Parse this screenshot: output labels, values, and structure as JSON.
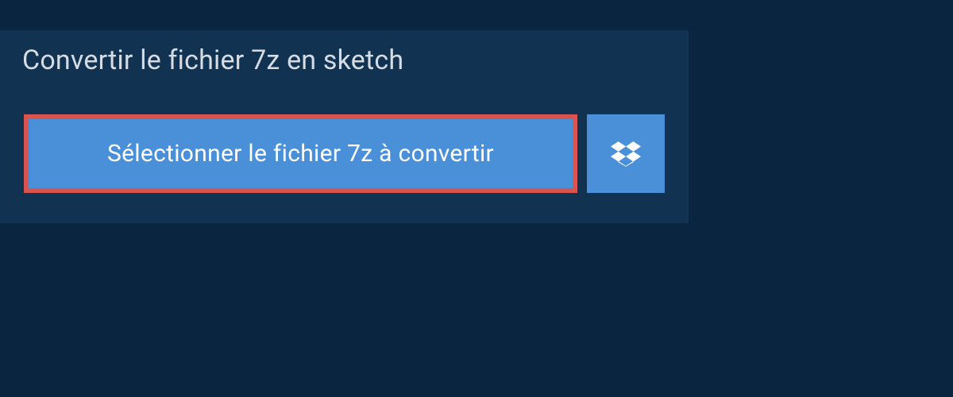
{
  "header": {
    "title": "Convertir le fichier 7z en sketch"
  },
  "actions": {
    "select_file_label": "Sélectionner le fichier 7z à convertir",
    "dropbox_label": "dropbox"
  },
  "colors": {
    "background": "#0a2540",
    "panel": "#123252",
    "button_bg": "#4a90d9",
    "button_border": "#d9534f",
    "text_light": "#d5dce3",
    "text_white": "#ffffff"
  }
}
